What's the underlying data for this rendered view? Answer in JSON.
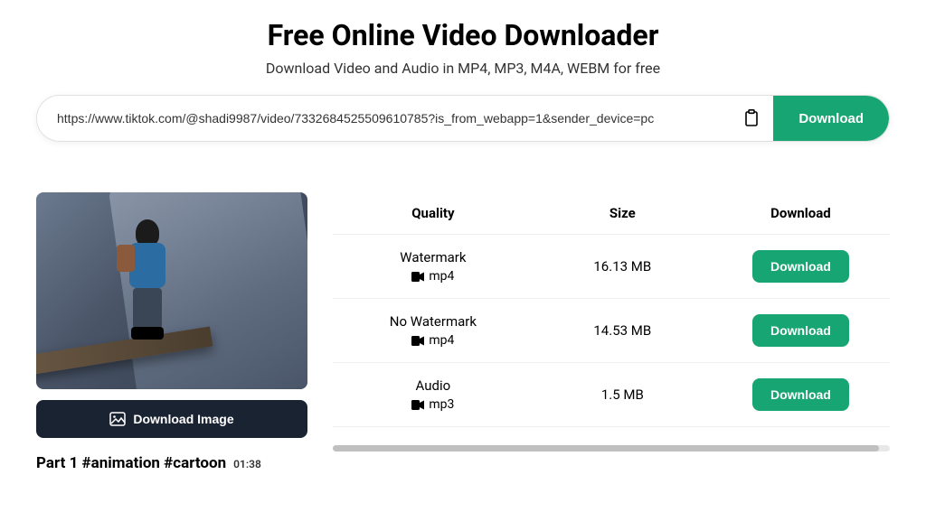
{
  "header": {
    "title": "Free Online Video Downloader",
    "subtitle": "Download Video and Audio in MP4, MP3, M4A, WEBM for free"
  },
  "search": {
    "url_value": "https://www.tiktok.com/@shadi9987/video/7332684525509610785?is_from_webapp=1&sender_device=pc",
    "download_label": "Download"
  },
  "video": {
    "download_image_label": "Download Image",
    "title": "Part 1 #animation #cartoon",
    "duration": "01:38"
  },
  "table": {
    "headers": {
      "quality": "Quality",
      "size": "Size",
      "download": "Download"
    },
    "rows": [
      {
        "quality_label": "Watermark",
        "format": "mp4",
        "format_icon": "video-icon",
        "size": "16.13 MB",
        "download_label": "Download"
      },
      {
        "quality_label": "No Watermark",
        "format": "mp4",
        "format_icon": "video-icon",
        "size": "14.53 MB",
        "download_label": "Download"
      },
      {
        "quality_label": "Audio",
        "format": "mp3",
        "format_icon": "video-icon",
        "size": "1.5 MB",
        "download_label": "Download"
      }
    ]
  },
  "colors": {
    "accent": "#17a673",
    "dark": "#1a2332"
  }
}
